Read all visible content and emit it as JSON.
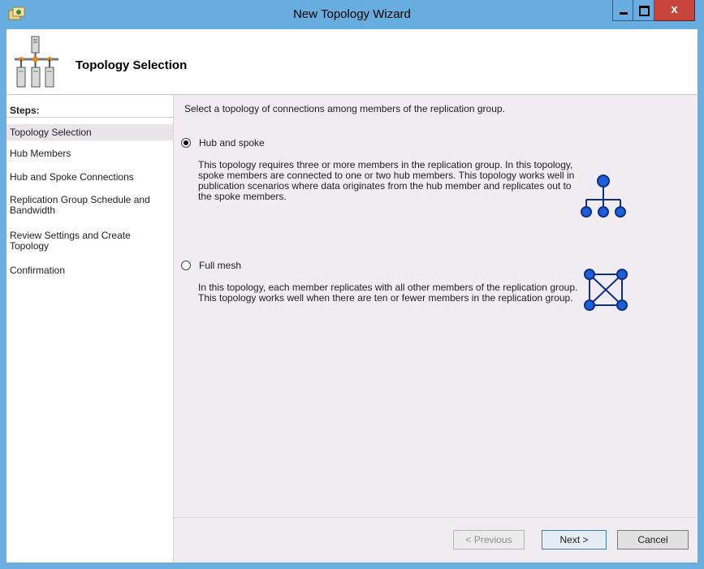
{
  "window": {
    "title": "New Topology Wizard",
    "close_glyph": "x"
  },
  "header": {
    "title": "Topology Selection",
    "icon": "server-topology-icon"
  },
  "sidebar": {
    "heading": "Steps:",
    "steps": [
      {
        "label": "Topology Selection",
        "active": true
      },
      {
        "label": "Hub Members"
      },
      {
        "label": "Hub and Spoke Connections"
      },
      {
        "label": "Replication Group Schedule and Bandwidth"
      },
      {
        "label": "Review Settings and Create Topology"
      },
      {
        "label": "Confirmation"
      }
    ]
  },
  "main": {
    "instruction": "Select a topology of connections among members of the replication group.",
    "options": [
      {
        "label": "Hub and spoke",
        "selected": true,
        "description": "This topology requires three or more members in the replication group. In this topology, spoke members are connected to one or two hub members. This topology works well in publication scenarios where data originates from the hub member and replicates out to the spoke members.",
        "icon": "hub-spoke-icon"
      },
      {
        "label": "Full mesh",
        "selected": false,
        "description": "In this topology, each member replicates with all other members of the replication group. This topology works well when there are ten or fewer members in the replication group.",
        "icon": "full-mesh-icon"
      }
    ]
  },
  "footer": {
    "previous": "< Previous",
    "next": "Next >",
    "cancel": "Cancel"
  },
  "colors": {
    "titlebar": "#68ade0",
    "close": "#c7453a",
    "panel": "#f1ecf1",
    "icon_blue": "#1e5fd6"
  }
}
